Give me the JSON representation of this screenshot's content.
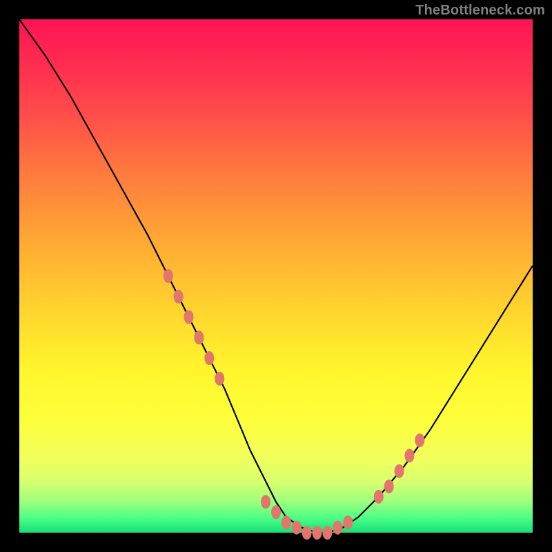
{
  "watermark": "TheBottleneck.com",
  "colors": {
    "page_bg": "#000000",
    "curve_stroke": "#000000",
    "marker_fill": "#e2756c",
    "watermark_text": "#808080"
  },
  "chart_data": {
    "type": "line",
    "title": "",
    "xlabel": "",
    "ylabel": "",
    "xlim": [
      0,
      100
    ],
    "ylim": [
      0,
      100
    ],
    "grid": false,
    "legend": false,
    "series": [
      {
        "name": "bottleneck-curve",
        "x": [
          0,
          5,
          10,
          15,
          20,
          25,
          30,
          35,
          40,
          45,
          48,
          50,
          52,
          55,
          58,
          60,
          63,
          66,
          70,
          75,
          80,
          85,
          90,
          95,
          100
        ],
        "values": [
          100,
          93,
          85,
          76,
          67,
          58,
          48,
          38,
          28,
          16,
          10,
          6,
          3,
          1,
          0,
          0,
          1,
          3,
          7,
          13,
          20,
          28,
          36,
          44,
          52
        ]
      }
    ],
    "markers": {
      "name": "highlight-dots",
      "x": [
        29,
        31,
        33,
        35,
        37,
        39,
        48,
        50,
        52,
        54,
        56,
        58,
        60,
        62,
        64,
        70,
        72,
        74,
        76,
        78
      ],
      "values": [
        50,
        46,
        42,
        38,
        34,
        30,
        6,
        4,
        2,
        1,
        0,
        0,
        0,
        1,
        2,
        7,
        9,
        12,
        15,
        18
      ]
    }
  }
}
